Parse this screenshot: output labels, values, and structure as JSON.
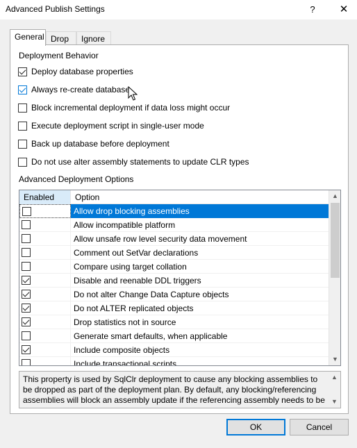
{
  "window": {
    "title": "Advanced Publish Settings",
    "help_glyph": "?",
    "close_glyph": "✕"
  },
  "tabs": [
    {
      "label": "General",
      "active": true
    },
    {
      "label": "Drop",
      "active": false
    },
    {
      "label": "Ignore",
      "active": false
    }
  ],
  "deployment_behavior": {
    "heading": "Deployment Behavior",
    "options": [
      {
        "label": "Deploy database properties",
        "checked": true
      },
      {
        "label": "Always re-create database",
        "checked": true
      },
      {
        "label": "Block incremental deployment if data loss might occur",
        "checked": false
      },
      {
        "label": "Execute deployment script in single-user mode",
        "checked": false
      },
      {
        "label": "Back up database before deployment",
        "checked": false
      },
      {
        "label": "Do not use alter assembly statements to update CLR types",
        "checked": false
      }
    ]
  },
  "advanced_options": {
    "heading": "Advanced Deployment Options",
    "columns": {
      "enabled": "Enabled",
      "option": "Option"
    },
    "rows": [
      {
        "option": "Allow drop blocking assemblies",
        "enabled": false,
        "selected": true
      },
      {
        "option": "Allow incompatible platform",
        "enabled": false
      },
      {
        "option": "Allow unsafe row level security data movement",
        "enabled": false
      },
      {
        "option": "Comment out SetVar declarations",
        "enabled": false
      },
      {
        "option": "Compare using target collation",
        "enabled": false
      },
      {
        "option": "Disable and reenable DDL triggers",
        "enabled": true
      },
      {
        "option": "Do not alter Change Data Capture objects",
        "enabled": true
      },
      {
        "option": "Do not ALTER replicated objects",
        "enabled": true
      },
      {
        "option": "Drop statistics not in source",
        "enabled": true
      },
      {
        "option": "Generate smart defaults, when applicable",
        "enabled": false
      },
      {
        "option": "Include composite objects",
        "enabled": true
      },
      {
        "option": "Include transactional scripts",
        "enabled": false
      }
    ]
  },
  "description": {
    "text": "This property is used by SqlClr deployment to cause any blocking assemblies to be dropped as part of the deployment plan. By default, any blocking/referencing assemblies will block an assembly update if the referencing assembly needs to be dropped."
  },
  "buttons": {
    "ok": "OK",
    "cancel": "Cancel"
  }
}
